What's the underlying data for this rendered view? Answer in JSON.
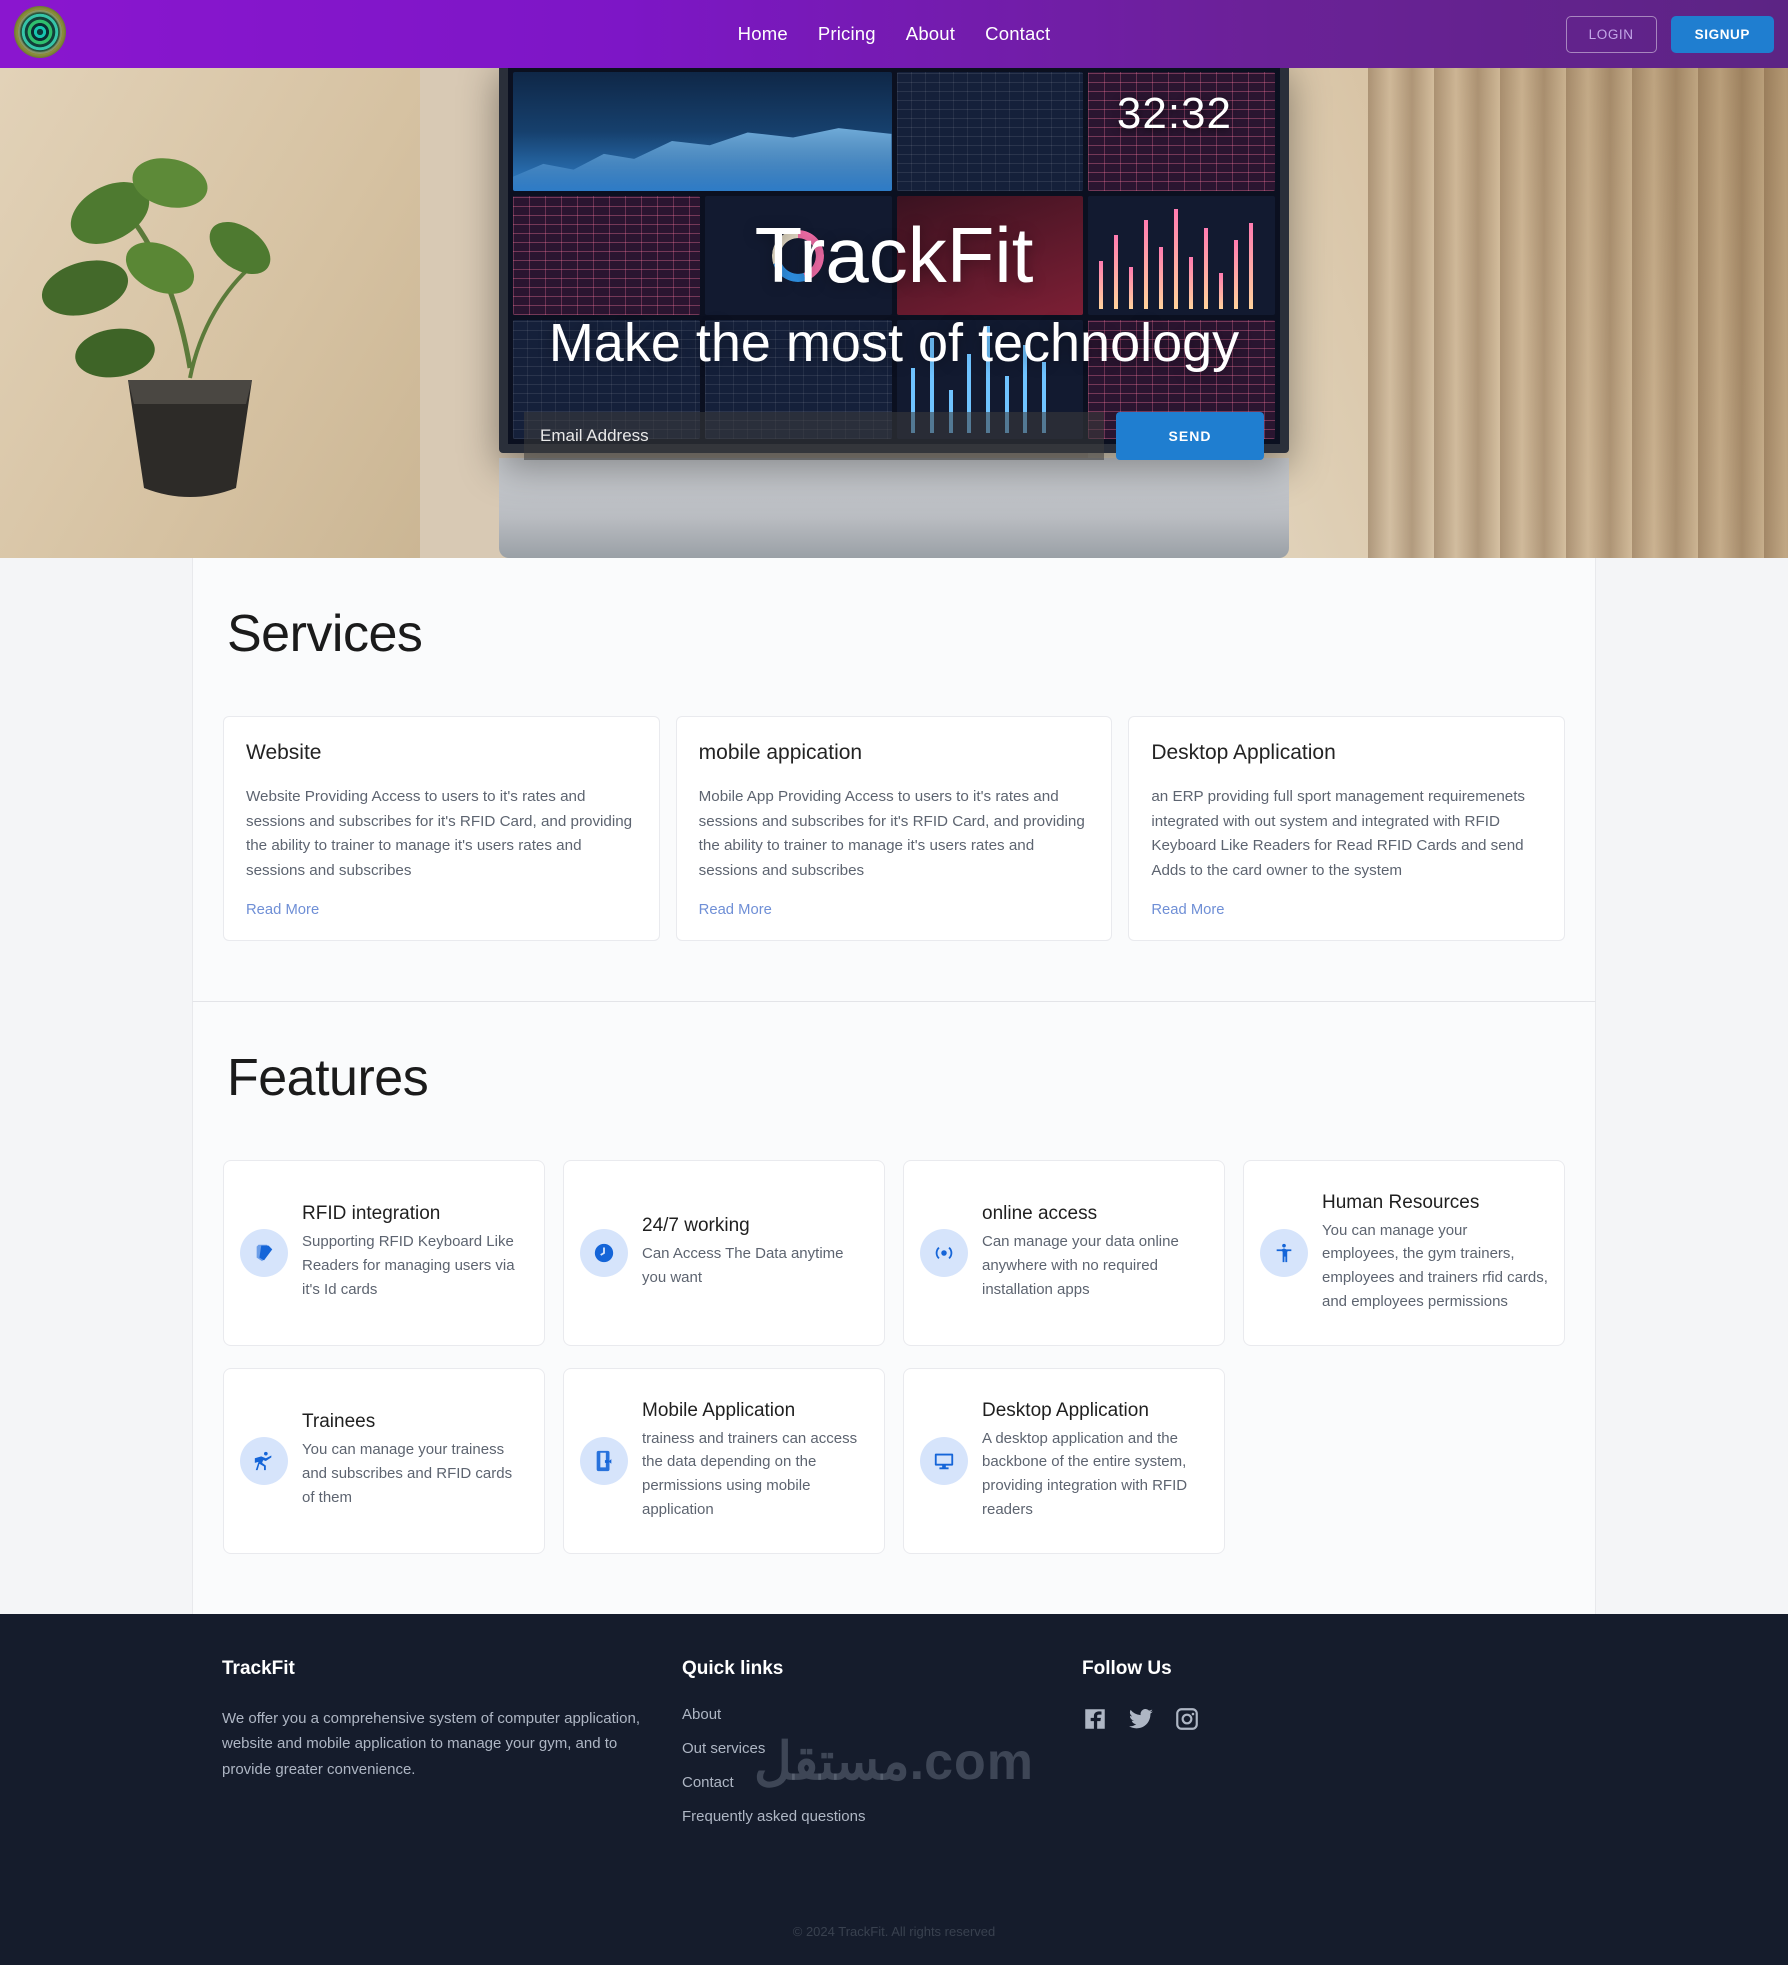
{
  "navbar": {
    "logo_name": "trackfit-logo",
    "links": [
      {
        "label": "Home"
      },
      {
        "label": "Pricing"
      },
      {
        "label": "About"
      },
      {
        "label": "Contact"
      }
    ],
    "login_label": "LOGIN",
    "signup_label": "SIGNUP",
    "bg_color": "#7d16c6",
    "signup_color": "#1f7ed0"
  },
  "hero": {
    "title": "TrackFit",
    "subtitle": "Make the most of technology",
    "email_placeholder": "Email Address",
    "email_value": "",
    "send_label": "SEND",
    "screen_timer": "32:32"
  },
  "services": {
    "title": "Services",
    "read_more_label": "Read More",
    "cards": [
      {
        "title": "Website",
        "body": "Website Providing Access to users to it's rates and sessions and subscribes for it's RFID Card, and providing the ability to trainer to manage it's users rates and sessions and subscribes",
        "link": "Read More"
      },
      {
        "title": "mobile appication",
        "body": "Mobile App Providing Access to users to it's rates and sessions and subscribes for it's RFID Card, and providing the ability to trainer to manage it's users rates and sessions and subscribes",
        "link": "Read More"
      },
      {
        "title": "Desktop Application",
        "body": "an ERP providing full sport management requiremenets integrated with out system and integrated with RFID Keyboard Like Readers for Read RFID Cards and send Adds to the card owner to the system",
        "link": "Read More"
      }
    ]
  },
  "features": {
    "title": "Features",
    "cards": [
      {
        "icon": "rfid-card-icon",
        "title": "RFID integration",
        "body": "Supporting RFID Keyboard Like Readers for managing users via it's Id cards"
      },
      {
        "icon": "clock-icon",
        "title": "24/7 working",
        "body": "Can Access The Data anytime you want"
      },
      {
        "icon": "broadcast-icon",
        "title": "online access",
        "body": "Can manage your data online anywhere with no required installation apps"
      },
      {
        "icon": "person-icon",
        "title": "Human Resources",
        "body": "You can manage your employees, the gym trainers, employees and trainers rfid cards, and employees permissions"
      },
      {
        "icon": "athlete-icon",
        "title": "Trainees",
        "body": "You can manage your trainess and subscribes and RFID cards of them"
      },
      {
        "icon": "mobile-download-icon",
        "title": "Mobile Application",
        "body": "trainess and trainers can access the data depending on the permissions using mobile application"
      },
      {
        "icon": "monitor-icon",
        "title": "Desktop Application",
        "body": "A desktop application and the backbone of the entire system, providing integration with RFID readers"
      }
    ]
  },
  "footer": {
    "brand": "TrackFit",
    "about": "We offer you a comprehensive system of computer application, website and mobile application to manage your gym, and to provide greater convenience.",
    "quick_links_title": "Quick links",
    "quick_links": [
      {
        "label": "About"
      },
      {
        "label": "Out services"
      },
      {
        "label": "Contact"
      },
      {
        "label": "Frequently asked questions"
      }
    ],
    "follow_title": "Follow Us",
    "socials": [
      {
        "name": "facebook-icon"
      },
      {
        "name": "twitter-icon"
      },
      {
        "name": "instagram-icon"
      }
    ],
    "copyright": "© 2024 TrackFit. All rights reserved",
    "watermark": "مستقل.com"
  }
}
